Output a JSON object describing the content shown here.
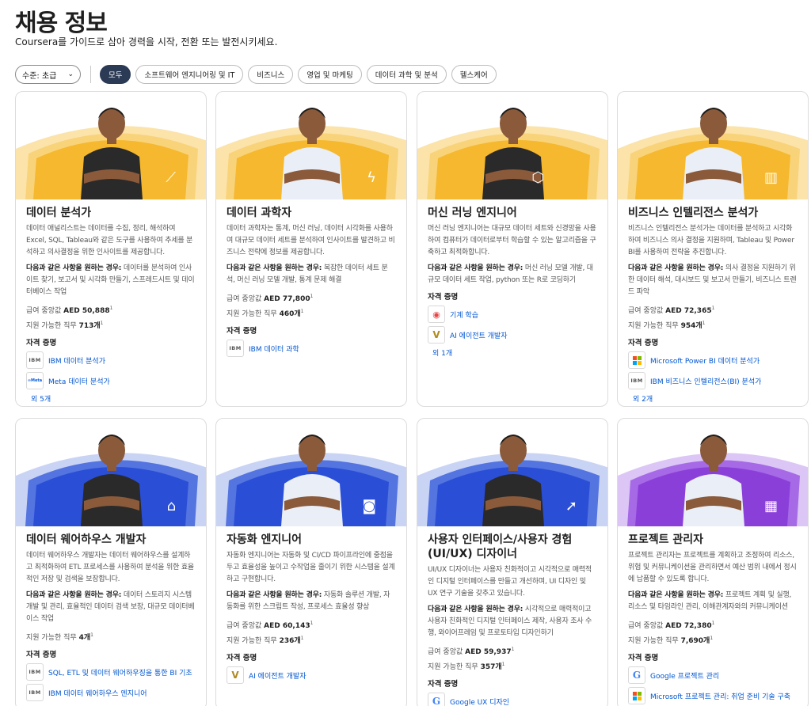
{
  "header": {
    "title": "채용 정보",
    "subtitle": "Coursera를 가이드로 삼아 경력을 시작, 전환 또는 발전시키세요."
  },
  "filters": {
    "level": "수준: 초급",
    "chips": [
      "모두",
      "소프트웨어 엔지니어링 및 IT",
      "비즈니스",
      "영업 및 마케팅",
      "데이터 과학 및 분석",
      "헬스케어"
    ],
    "active": "모두"
  },
  "labels": {
    "needs_prefix": "다음과 같은 사항을 원하는 경우:",
    "salary_prefix": "급여 중앙값",
    "jobs_prefix": "지원 가능한 직무",
    "certs_heading": "자격 증명"
  },
  "colors": {
    "accent_yellow": "#f5b82e",
    "accent_blue": "#2a4fd6",
    "accent_purple": "#8b3fd9",
    "link": "#0056d2"
  },
  "cards": [
    {
      "title": "데이터 분석가",
      "desc": "데이터 애널리스트는 데이터를 수집, 정리, 해석하여 Excel, SQL, Tableau와 같은 도구를 사용하여 추세를 분석하고 의사결정을 위한 인사이트를 제공합니다.",
      "needs": "데이터를 분석하여 인사이트 찾기, 보고서 및 시각화 만들기, 스프레드시트 및 데이터베이스 작업",
      "salary": "AED 50,888",
      "jobs": "713개",
      "certs": [
        {
          "logo": "IBM",
          "name": "IBM 데이터 분석가"
        },
        {
          "logo": "Meta",
          "name": "Meta 데이터 분석가"
        }
      ],
      "more": "외 5개",
      "icon": "chart-icon",
      "hero_color": "yellow"
    },
    {
      "title": "데이터 과학자",
      "desc": "데이터 과학자는 통계, 머신 러닝, 데이터 시각화를 사용하여 대규모 데이터 세트를 분석하여 인사이트를 발견하고 비즈니스 전략에 정보를 제공합니다.",
      "needs": "복잡한 데이터 세트 분석, 머신 러닝 모델 개발, 통계 문제 해결",
      "salary": "AED 77,800",
      "jobs": "460개",
      "certs": [
        {
          "logo": "IBM",
          "name": "IBM 데이터 과학"
        }
      ],
      "more": "",
      "icon": "lightning-icon",
      "hero_color": "yellow"
    },
    {
      "title": "머신 러닝 엔지니어",
      "desc": "머신 러닝 엔지니어는 대규모 데이터 세트와 신경망을 사용하여 컴퓨터가 데이터로부터 학습할 수 있는 알고리즘을 구축하고 최적화합니다.",
      "needs": "머신 러닝 모델 개발, 대규모 데이터 세트 작업, python 또는 R로 코딩하기",
      "salary": "",
      "jobs": "",
      "certs": [
        {
          "logo": "robot",
          "name": "기계 학습"
        },
        {
          "logo": "V",
          "name": "AI 에이전트 개발자"
        }
      ],
      "more": "외 1개",
      "icon": "hexagon-icon",
      "hero_color": "yellow"
    },
    {
      "title": "비즈니스 인텔리전스 분석가",
      "desc": "비즈니스 인텔리전스 분석가는 데이터를 분석하고 시각화하여 비즈니스 의사 결정을 지원하며, Tableau 및 Power BI를 사용하여 전략을 추진합니다.",
      "needs": "의사 결정을 지원하기 위한 데이터 해석, 대시보드 및 보고서 만들기, 비즈니스 트렌드 파악",
      "salary": "AED 72,365",
      "jobs": "954개",
      "certs": [
        {
          "logo": "MS",
          "name": "Microsoft Power BI 데이터 분석가"
        },
        {
          "logo": "IBM",
          "name": "IBM 비즈니스 인텔리전스(BI) 분석가"
        }
      ],
      "more": "외 2개",
      "icon": "bar-chart-icon",
      "hero_color": "yellow"
    },
    {
      "title": "데이터 웨어하우스 개발자",
      "desc": "데이터 웨어하우스 개발자는 데이터 웨어하우스를 설계하고 최적화하여 ETL 프로세스를 사용하여 분석을 위한 효율적인 저장 및 검색을 보장합니다.",
      "needs": "데이터 스토리지 시스템 개발 및 관리, 효율적인 데이터 검색 보장, 대규모 데이터베이스 작업",
      "salary": "",
      "jobs": "4개",
      "certs": [
        {
          "logo": "IBM",
          "name": "SQL, ETL 및 데이터 웨어하우징을 통한 BI 기초"
        },
        {
          "logo": "IBM",
          "name": "IBM 데이터 웨어하우스 엔지니어"
        }
      ],
      "more": "",
      "icon": "warehouse-icon",
      "hero_color": "blue"
    },
    {
      "title": "자동화 엔지니어",
      "desc": "자동화 엔지니어는 자동화 및 CI/CD 파이프라인에 중점을 두고 효율성을 높이고 수작업을 줄이기 위한 시스템을 설계하고 구현합니다.",
      "needs": "자동화 솔루션 개발, 자동화를 위한 스크립트 작성, 프로세스 효율성 향상",
      "salary": "AED 60,143",
      "jobs": "236개",
      "certs": [
        {
          "logo": "V",
          "name": "AI 에이전트 개발자"
        }
      ],
      "more": "",
      "icon": "robot-icon",
      "hero_color": "blue"
    },
    {
      "title": "사용자 인터페이스/사용자 경험 (UI/UX) 디자이너",
      "desc": "UI/UX 디자이너는 사용자 친화적이고 시각적으로 매력적인 디지털 인터페이스를 만들고 개선하며, UI 디자인 및 UX 연구 기술을 갖추고 있습니다.",
      "needs": "시각적으로 매력적이고 사용자 친화적인 디지털 인터페이스 제작, 사용자 조사 수행, 와이어프레임 및 프로토타입 디자인하기",
      "salary": "AED 59,937",
      "jobs": "357개",
      "certs": [
        {
          "logo": "G",
          "name": "Google UX 디자인"
        }
      ],
      "more": "",
      "icon": "cursor-icon",
      "hero_color": "blue"
    },
    {
      "title": "프로젝트 관리자",
      "desc": "프로젝트 관리자는 프로젝트를 계획하고 조정하여 리소스, 위험 및 커뮤니케이션을 관리하면서 예산 범위 내에서 정시에 납품할 수 있도록 합니다.",
      "needs": "프로젝트 계획 및 실행, 리소스 및 타임라인 관리, 이해관계자와의 커뮤니케이션",
      "salary": "AED 72,380",
      "jobs": "7,690개",
      "certs": [
        {
          "logo": "G",
          "name": "Google 프로젝트 관리"
        },
        {
          "logo": "MS",
          "name": "Microsoft 프로젝트 관리: 취업 준비 기술 구축"
        }
      ],
      "more": "",
      "icon": "calendar-icon",
      "hero_color": "purple"
    }
  ]
}
